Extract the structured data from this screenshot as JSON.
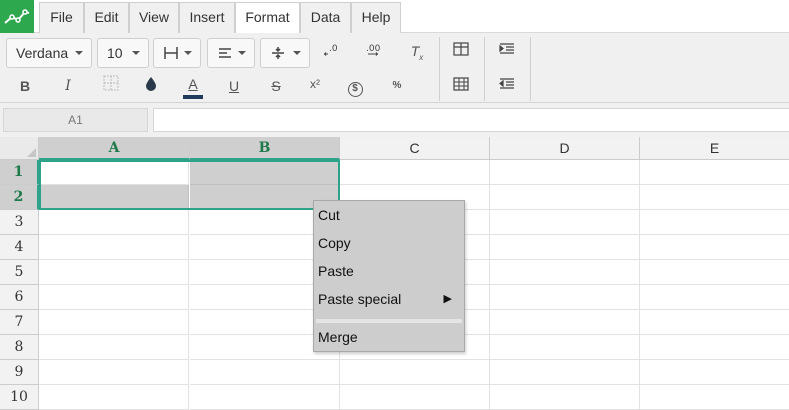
{
  "app": {
    "logo": "spreadsheet-logo-icon",
    "accent": "#2ea84f"
  },
  "menu": {
    "file": "File",
    "edit": "Edit",
    "view": "View",
    "insert": "Insert",
    "format": "Format",
    "data": "Data",
    "help": "Help",
    "active": "Format"
  },
  "toolbar": {
    "font": "Verdana",
    "font_size": "10",
    "bold": "B",
    "italic": "I",
    "underline": "U",
    "strike": "S",
    "superscript": "x²",
    "currency": "$",
    "percent": "%",
    "text_color": "A",
    "clear": "T",
    "text_color_value": "#1f3a5a"
  },
  "formula_bar": {
    "cell_ref": "A1",
    "value": ""
  },
  "grid": {
    "columns": [
      "A",
      "B",
      "C",
      "D",
      "E"
    ],
    "rows": [
      "1",
      "2",
      "3",
      "4",
      "5",
      "6",
      "7",
      "8",
      "9",
      "10"
    ],
    "selection": "A1:B2",
    "selection_color": "#2ea38a"
  },
  "context_menu": {
    "cut": "Cut",
    "copy": "Copy",
    "paste": "Paste",
    "paste_special": "Paste special",
    "submenu_arrow": "▶",
    "merge": "Merge"
  }
}
